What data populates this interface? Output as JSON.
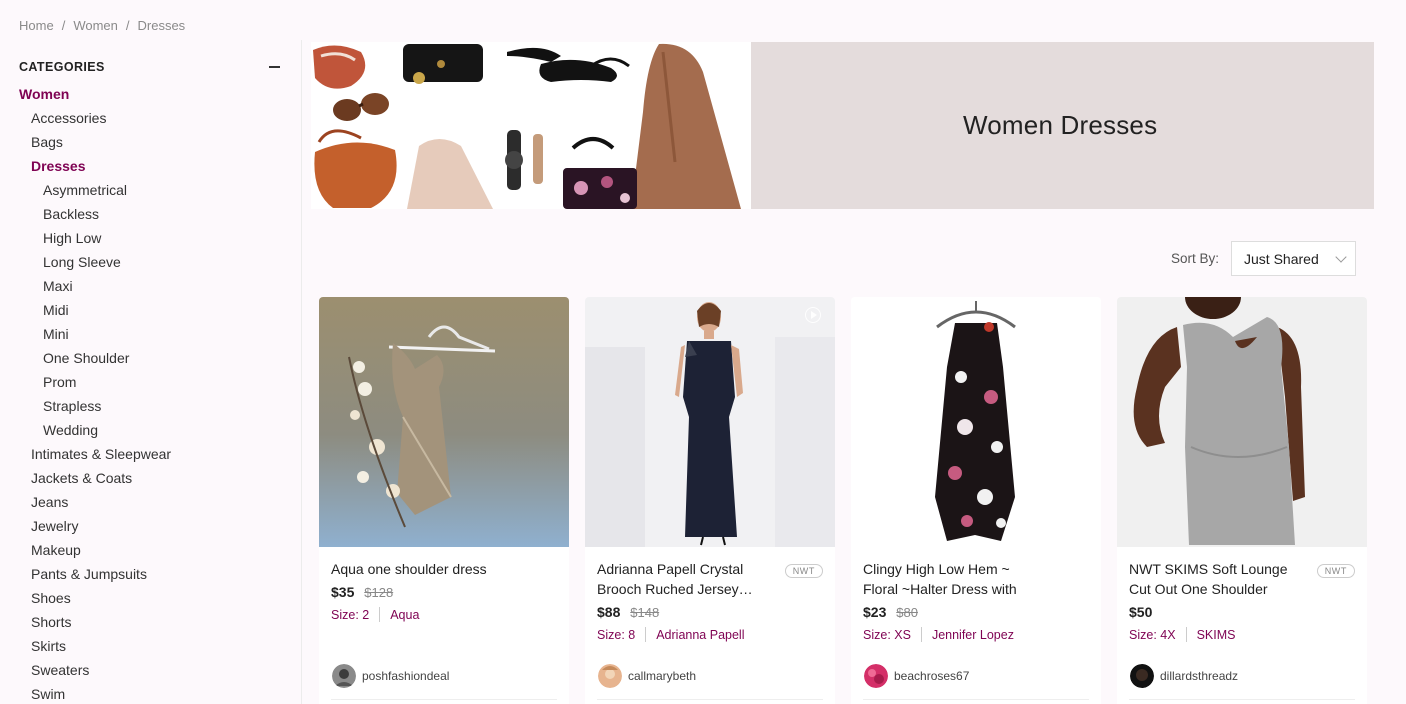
{
  "breadcrumb": [
    "Home",
    "/",
    "Women",
    "/",
    "Dresses"
  ],
  "sidebar": {
    "title": "CATEGORIES",
    "items": [
      {
        "label": "Women",
        "level": 0,
        "active": true
      },
      {
        "label": "Accessories",
        "level": 1
      },
      {
        "label": "Bags",
        "level": 1
      },
      {
        "label": "Dresses",
        "level": 1,
        "active": true
      },
      {
        "label": "Asymmetrical",
        "level": 2
      },
      {
        "label": "Backless",
        "level": 2
      },
      {
        "label": "High Low",
        "level": 2
      },
      {
        "label": "Long Sleeve",
        "level": 2
      },
      {
        "label": "Maxi",
        "level": 2
      },
      {
        "label": "Midi",
        "level": 2
      },
      {
        "label": "Mini",
        "level": 2
      },
      {
        "label": "One Shoulder",
        "level": 2
      },
      {
        "label": "Prom",
        "level": 2
      },
      {
        "label": "Strapless",
        "level": 2
      },
      {
        "label": "Wedding",
        "level": 2
      },
      {
        "label": "Intimates & Sleepwear",
        "level": 1
      },
      {
        "label": "Jackets & Coats",
        "level": 1
      },
      {
        "label": "Jeans",
        "level": 1
      },
      {
        "label": "Jewelry",
        "level": 1
      },
      {
        "label": "Makeup",
        "level": 1
      },
      {
        "label": "Pants & Jumpsuits",
        "level": 1
      },
      {
        "label": "Shoes",
        "level": 1
      },
      {
        "label": "Shorts",
        "level": 1
      },
      {
        "label": "Skirts",
        "level": 1
      },
      {
        "label": "Sweaters",
        "level": 1
      },
      {
        "label": "Swim",
        "level": 1
      }
    ]
  },
  "banner": {
    "title": "Women Dresses"
  },
  "sort": {
    "label": "Sort By:",
    "value": "Just Shared"
  },
  "colors": {
    "accent": "#7f0353",
    "banner_bg": "#e4dcdc",
    "page_bg": "#fdf9fc"
  },
  "listings": [
    {
      "title": "Aqua one shoulder dress",
      "price": "$35",
      "original_price": "$128",
      "size": "Size: 2",
      "brand": "Aqua",
      "badge": "",
      "seller": "poshfashiondeal",
      "video": false
    },
    {
      "title": "Adrianna Papell Crystal Brooch Ruched Jersey…",
      "price": "$88",
      "original_price": "$148",
      "size": "Size: 8",
      "brand": "Adrianna Papell",
      "badge": "NWT",
      "seller": "callmarybeth",
      "video": true
    },
    {
      "title": "Clingy High Low Hem ~ Floral ~Halter Dress with Neckline…",
      "price": "$23",
      "original_price": "$80",
      "size": "Size: XS",
      "brand": "Jennifer Lopez",
      "badge": "",
      "seller": "beachroses67",
      "video": false
    },
    {
      "title": "NWT SKIMS Soft Lounge Cut Out One Shoulder Dres…",
      "price": "$50",
      "original_price": "",
      "size": "Size: 4X",
      "brand": "SKIMS",
      "badge": "NWT",
      "seller": "dillardsthreadz",
      "video": false
    }
  ]
}
